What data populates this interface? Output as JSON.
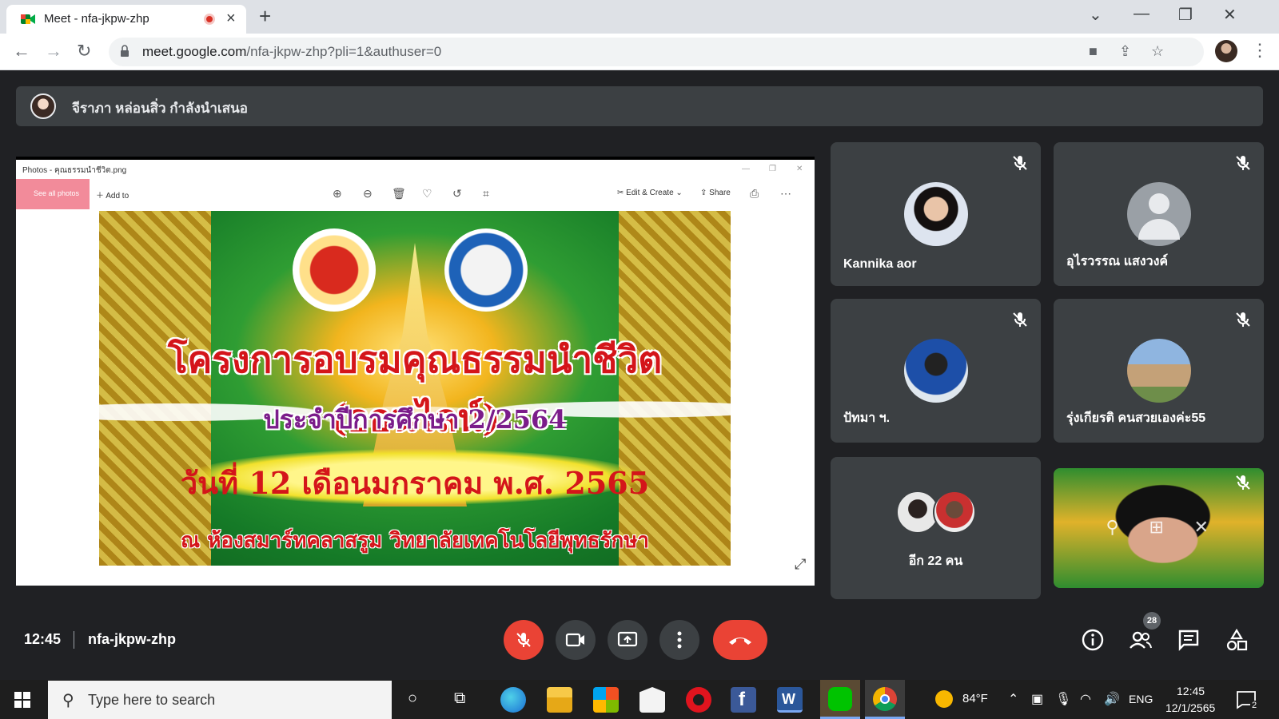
{
  "browser": {
    "tab_title": "Meet - nfa-jkpw-zhp",
    "url_host": "meet.google.com",
    "url_path": "/nfa-jkpw-zhp?pli=1&authuser=0"
  },
  "meet": {
    "presenting_text": "จีราภา หล่อนสิ่ว กำลังนำเสนอ",
    "time": "12:45",
    "meeting_code": "nfa-jkpw-zhp",
    "people_count": "28"
  },
  "shared_screen": {
    "window_title": "Photos - คุณธรรมนำชีวิต.png",
    "toolbar": {
      "see_all": "See all photos",
      "add_to": "Add to",
      "edit_create": "Edit & Create",
      "share": "Share"
    },
    "banner": {
      "title": "โครงการอบรมคุณธรรมนำชีวิต (ออนไลน์)",
      "subtitle": "ประจำปีการศึกษา 2/2564",
      "date": "วันที่ 12 เดือนมกราคม พ.ศ. 2565",
      "place": "ณ ห้องสมาร์ทคลาสรูม วิทยาลัยเทคโนโลยีพุทธรักษา"
    }
  },
  "participants": [
    {
      "name": "Kannika aor"
    },
    {
      "name": "อุไรวรรณ แสงวงค์"
    },
    {
      "name": "ปัทมา ฯ."
    },
    {
      "name": "รุ่งเกียรติ คนสวยเองค่ะ55"
    }
  ],
  "more_participants_label": "อีก 22 คน",
  "taskbar": {
    "search_placeholder": "Type here to search",
    "weather": "84°F",
    "language": "ENG",
    "clock_time": "12:45",
    "clock_date": "12/1/2565",
    "notification_count": "2"
  },
  "colors": {
    "meet_background": "#202124",
    "tile": "#3c4043",
    "end_call": "#ea4335"
  }
}
